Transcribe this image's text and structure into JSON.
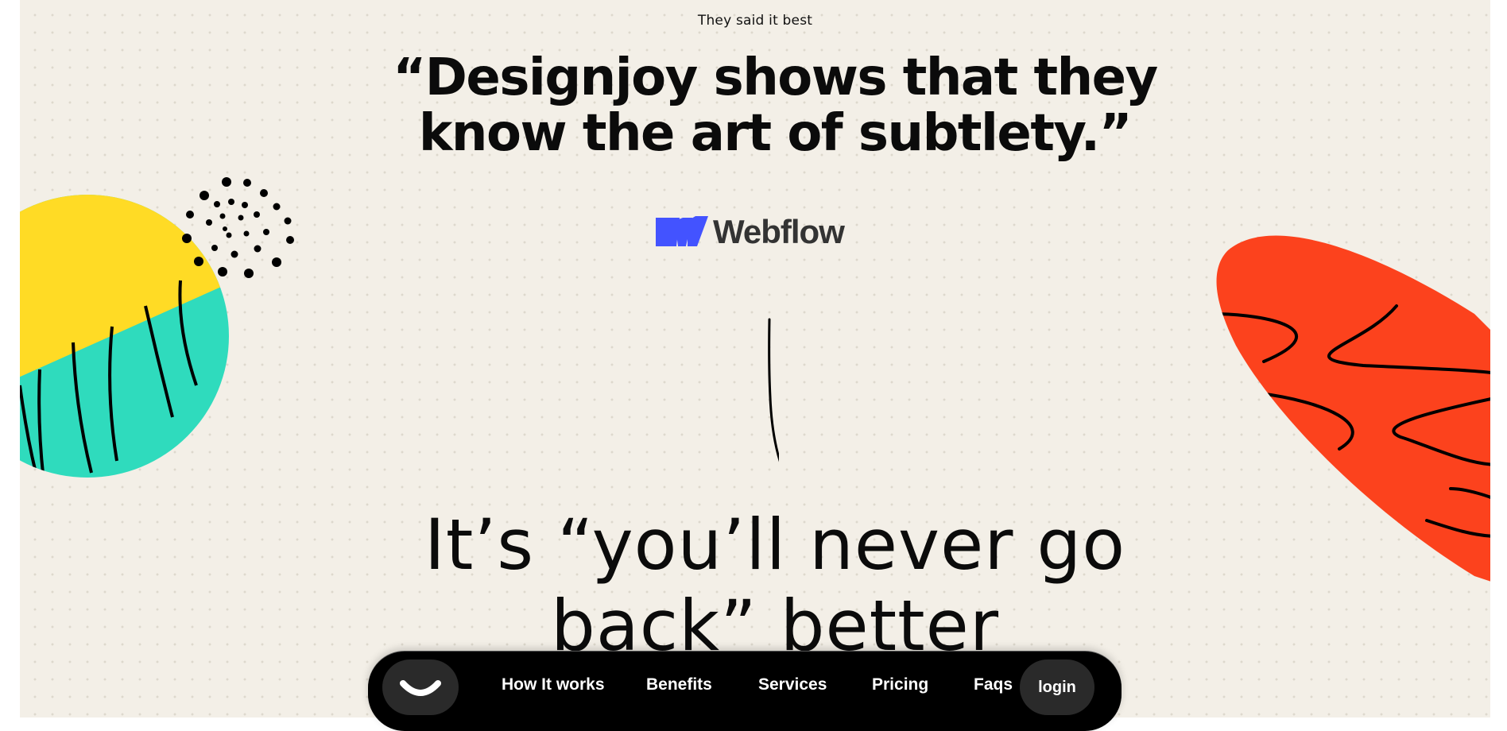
{
  "testimonial": {
    "eyebrow": "They said it best",
    "quote_line1": "“Designjoy shows that they",
    "quote_line2": "know the art of subtlety.”",
    "brand_name": "Webflow"
  },
  "headline": {
    "line1": "It’s “you’ll never go",
    "line2": "back” better"
  },
  "nav": {
    "logo_icon": "smile-icon",
    "links": [
      "How It works",
      "Benefits",
      "Services",
      "Pricing",
      "Faqs"
    ],
    "login_label": "login"
  },
  "colors": {
    "background": "#f3efe7",
    "yellow": "#ffdb25",
    "teal": "#2fdbbd",
    "red": "#fc421d",
    "webflow_blue": "#4353ff",
    "nav_bg": "#000000"
  }
}
